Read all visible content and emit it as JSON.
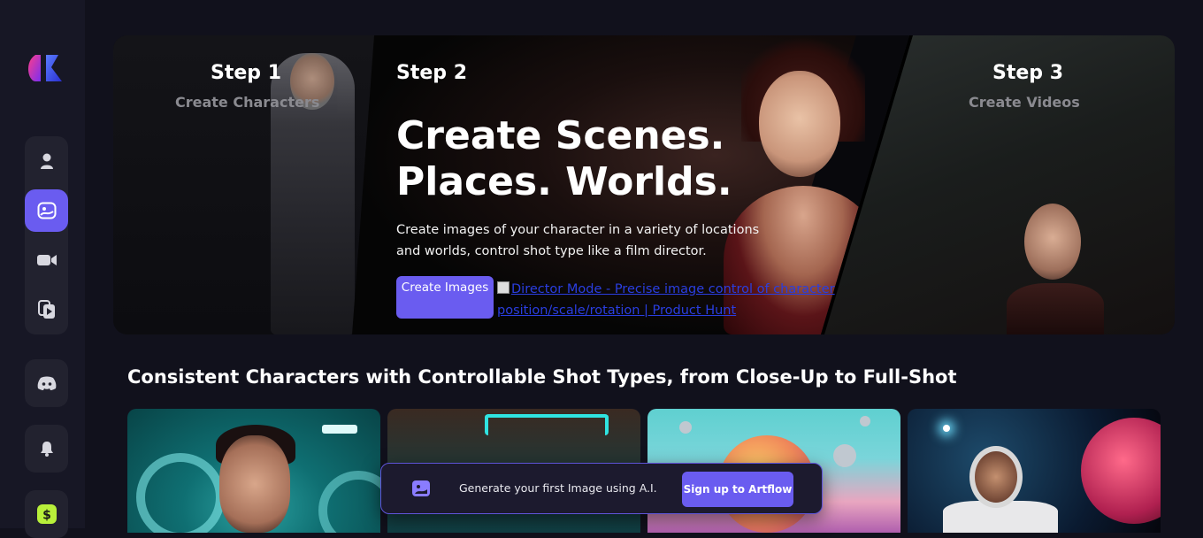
{
  "sidebar": {
    "logo": "artflow-logo",
    "items": [
      {
        "icon": "user-icon",
        "active": false
      },
      {
        "icon": "image-icon",
        "active": true
      },
      {
        "icon": "video-camera-icon",
        "active": false
      },
      {
        "icon": "video-files-icon",
        "active": false
      },
      {
        "icon": "discord-icon",
        "active": false
      },
      {
        "icon": "bell-icon",
        "active": false
      },
      {
        "icon": "dollar-icon",
        "active": false
      }
    ]
  },
  "hero": {
    "step1": {
      "title": "Step 1",
      "subtitle": "Create Characters"
    },
    "step2": {
      "title": "Step 2"
    },
    "step3": {
      "title": "Step 3",
      "subtitle": "Create Videos"
    },
    "headline_line1": "Create Scenes.",
    "headline_line2": "Places. Worlds.",
    "description": "Create images of your character in a variety of locations and worlds, control shot type like a film director.",
    "cta_label": "Create Images",
    "product_hunt_alt": "Director Mode - Precise image control of character position/scale/rotation | Product Hunt"
  },
  "section": {
    "title": "Consistent Characters with Controllable Shot Types, from Close-Up to Full-Shot"
  },
  "toast": {
    "message": "Generate your first Image using A.I.",
    "button_label": "Sign up to Artflow"
  },
  "colors": {
    "accent": "#6a5cf0",
    "background": "#11111c",
    "sidebar": "#171725"
  }
}
